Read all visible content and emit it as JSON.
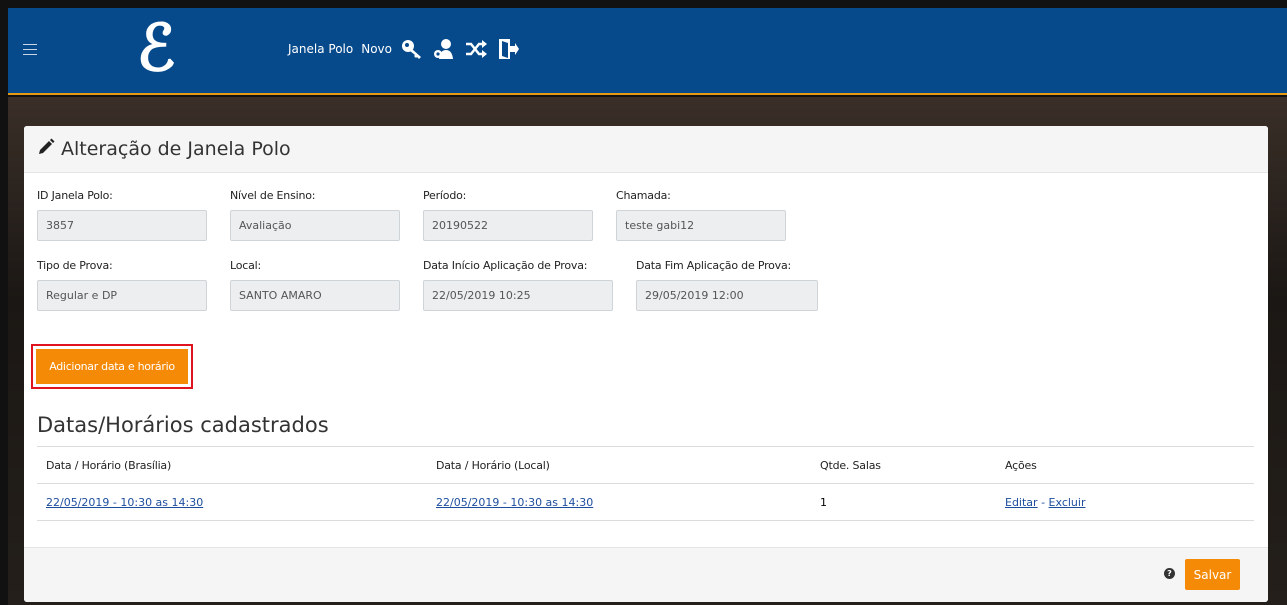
{
  "header": {
    "logo_text": "ℰ",
    "nav_links": [
      "Janela Polo",
      "Novo"
    ],
    "icons": [
      "key-icon",
      "user-gear-icon",
      "shuffle-icon",
      "logout-icon"
    ]
  },
  "card": {
    "title": "Alteração de Janela Polo",
    "fields": [
      {
        "label": "ID Janela Polo:",
        "value": "3857"
      },
      {
        "label": "Nível de Ensino:",
        "value": "Avaliação"
      },
      {
        "label": "Período:",
        "value": "20190522"
      },
      {
        "label": "Chamada:",
        "value": "teste gabi12"
      },
      {
        "label": "Tipo de Prova:",
        "value": "Regular e DP"
      },
      {
        "label": "Local:",
        "value": "SANTO AMARO"
      },
      {
        "label": "Data Início Aplicação de Prova:",
        "value": "22/05/2019 10:25"
      },
      {
        "label": "Data Fim Aplicação de Prova:",
        "value": "29/05/2019 12:00"
      }
    ],
    "add_button": "Adicionar data e horário",
    "section_title": "Datas/Horários cadastrados",
    "table": {
      "headers": [
        "Data / Horário (Brasília)",
        "Data / Horário (Local)",
        "Qtde. Salas",
        "Ações"
      ],
      "rows": [
        {
          "brasilia": "22/05/2019 - 10:30 as 14:30",
          "local": "22/05/2019 - 10:30 as 14:30",
          "salas": "1",
          "edit": "Editar",
          "sep": " - ",
          "delete": "Excluir"
        }
      ]
    },
    "footer": {
      "help": "?",
      "save": "Salvar"
    }
  },
  "colors": {
    "topbar": "#064a8c",
    "accent": "#f58a07",
    "highlight": "#e0141e",
    "link": "#1d4e9e"
  }
}
